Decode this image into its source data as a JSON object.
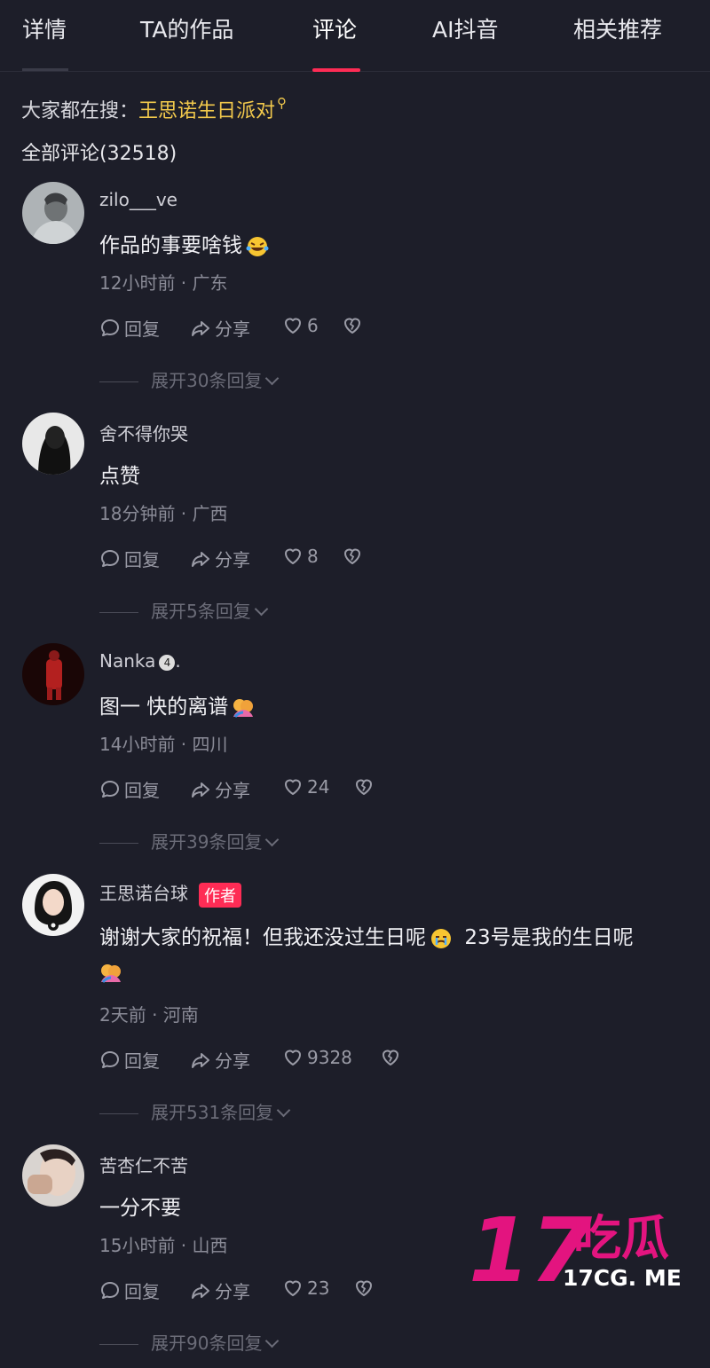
{
  "tabs": [
    {
      "label": "详情"
    },
    {
      "label": "TA的作品"
    },
    {
      "label": "评论"
    },
    {
      "label": "AI抖音"
    },
    {
      "label": "相关推荐"
    }
  ],
  "search_hint": {
    "prefix": "大家都在搜：",
    "keyword": "王思诺生日派对"
  },
  "total_comments": "全部评论(32518)",
  "reply_label": "回复",
  "share_label": "分享",
  "comments": [
    {
      "user": "zilo___ve",
      "text": "作品的事要啥钱",
      "emoji": "laughing-tears-emoji",
      "meta": "12小时前 · 广东",
      "likes": "6",
      "expand": "展开30条回复"
    },
    {
      "user": "舍不得你哭",
      "text": "点赞",
      "meta": "18分钟前 · 广西",
      "likes": "8",
      "expand": "展开5条回复"
    },
    {
      "user": "Nanka",
      "user_badge": "4",
      "user_suffix": ".",
      "text": "图一 快的离谱",
      "emoji": "hug-emoji",
      "meta": "14小时前 · 四川",
      "likes": "24",
      "expand": "展开39条回复"
    },
    {
      "user": "王思诺台球",
      "author_tag": "作者",
      "text": "谢谢大家的祝福！但我还没过生日呢",
      "text2": "23号是我的生日呢",
      "emoji": "crying-emoji",
      "emoji2": "hug-emoji",
      "meta": "2天前 · 河南",
      "likes": "9328",
      "expand": "展开531条回复"
    },
    {
      "user": "苦杏仁不苦",
      "text": "一分不要",
      "meta": "15小时前 · 山西",
      "likes": "23",
      "expand": "展开90条回复"
    }
  ],
  "watermark": {
    "big": "17",
    "cn": "吃瓜",
    "site": "17CG. ME",
    "color": "#e3147f"
  },
  "colors": {
    "background": "#1d1e29",
    "accent": "#fe2c55",
    "keyword": "#f2c94c"
  }
}
